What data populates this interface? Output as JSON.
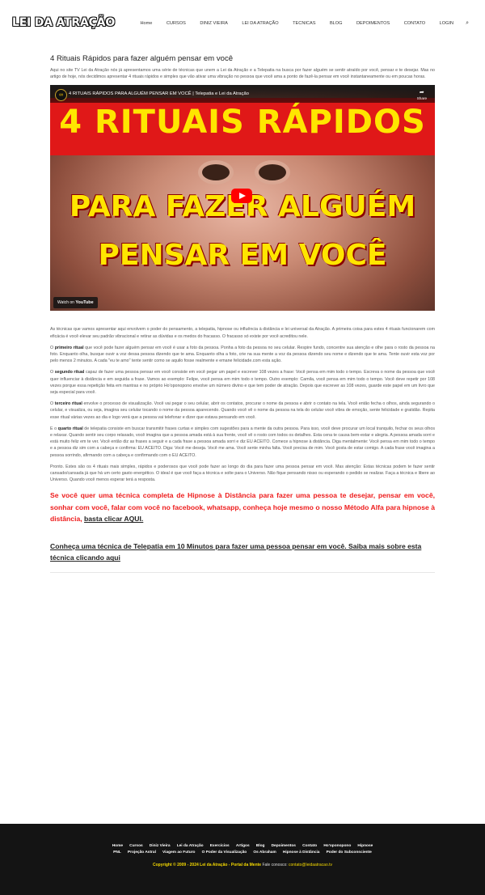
{
  "header": {
    "logo": "LEI DA ATRAÇÃO",
    "nav": [
      "Home",
      "CURSOS",
      "DINIZ VIEIRA",
      "LEI DA ATRAÇÃO",
      "TECNICAS",
      "BLOG",
      "DEPOIMENTOS",
      "CONTATO",
      "LOGIN"
    ],
    "search_icon": "⌕"
  },
  "article": {
    "title": "4 Rituais Rápidos para fazer alguém pensar em você",
    "intro": "Aqui no site TV Lei da Atração nós já apresentamos uma série de técnicas que unem a Lei da Atração e a Telepatia na busca por fazer alguém se sentir atraído por você, pensar e te desejar. Mas no artigo de hoje, nós decidimos apresentar 4 rituais rápidos e simples que vão ativar uma vibração no pessoa que você ama a ponto de fazê-la pensar em você instantaneamente ou em poucas horas.",
    "video": {
      "title": "4 RITUAIS RÁPIDOS PARA ALGUÉM PENSAR EM VOCÊ | Telepatia e Lei da Atração",
      "share": "Share",
      "headline1": "4 RITUAIS RÁPIDOS",
      "headline2": "PARA FAZER ALGUÉM",
      "headline3": "PENSAR EM VOCÊ",
      "watch_on": "Watch on",
      "youtube": "YouTube"
    },
    "p1": "As técnicas que vamos apresentar aqui envolvem o poder do pensamento, a telepatia, hipnose ou influência à distância e lei universal da Atração. A primeira coisa para estes 4 rituais funcionarem com eficácia é você elevar seu padrão vibracional e retirar as dúvidas e os medos do fracasso. O fracasso só existe por você acreditou nele.",
    "r1_label": "primeiro ritual",
    "r1_pre": "O ",
    "r1_text": " que você pode fazer alguém pensar em você é usar a foto da pessoa. Ponha a foto da pessoa no seu celular. Respire fundo, concentre sua atenção e olhe para o rosto da pessoa na foto. Enquanto olha, busque ouvir a voz dessa pessoa dizendo que te ama. Enquanto olha a foto, crie na sua mente a voz da pessoa dizendo seu nome e dizendo que te ama. Tente ouvir esta voz por pelo menos 2 minutos. A cada \"eu te amo\" tente sentir como se aquilo fosse realmente e emane felicidade.com esta ação.",
    "r2_label": "segundo ritual",
    "r2_pre": "O ",
    "r2_text": " capaz de fazer uma pessoa pensar em você consiste em você pegar um papel e escrever 108 vezes a frase: Você pensa em mim todo o tempo. Escreva o nome da pessoa que você quer influenciar à distância e em seguida a frase. Vamos ao exemplo: Felipe, você pensa em mim todo o tempo. Outro exemplo: Camila, você pensa em mim todo o tempo. Você deve repetir por 108 vezes porque essa repetição feita em mantras e no próprio Ho'oponopono envolve um número divino e que tem poder de atração. Depois que escrever as 108 vezes, guarde este papel em um livro que seja especial para você.",
    "r3_label": "terceiro ritual",
    "r3_pre": "O ",
    "r3_text": " envolve o processo de visualização. Você vai pegar o seu celular, abrir os contatos, procurar o nome da pessoa e abrir o contato na tela. Você então fecha o olhos, ainda segurando o celular, e visualiza, ou seja, imagina seu celular tocando o nome da pessoa aparecendo. Quando você vê o nome da pessoa na tela do celular você vibra de emoção, sente felicidade e gratidão. Repita esse ritual várias vezes ao dia e logo verá que a pessoa vai telefonar e dizer que estava pensando em você.",
    "r4_label": "quarto ritual",
    "r4_pre": "E o ",
    "r4_text": " de telepatia consiste em buscar transmitir frases curtas e simples com sugestões para a mente da outra pessoa. Para isso, você deve procurar um local tranquilo, fechar os seus olhos e relaxar. Quando sentir seu corpo relaxado, você imagina que a pessoa amada está à sua frente, você vê o rosto com todos os detalhes. Esta cena te causa bem-estar e alegria. A pessoa amada sorri e está muito feliz em te ver. Você então diz as frases a seguir e a cada frase a pessoa amada sorri e diz EU ACEITO. Comece a hipnose à distância. Diga mentalmente: Você pensa em mim todo o tempo e a pessoa diz sim com a cabeça e confirma: EU ACEITO. Diga: Você me deseja. Você me ama. Você sente minha falta. Você precisa de mim. Você gosta de estar comigo. A cada frase você imagina a pessoa sorrindo, afirmando com a cabeça e confirmando com o EU ACEITO.",
    "p_end": "Pronto. Estes são os 4 rituais mais simples, rápidos e poderosos que você pode fazer ao longo do dia para fazer uma pessoa pensar em você. Mas atenção: Estas técnicas podem te fazer sentir cansado/cansada já que há um certo gasto energético. O ideal é que você faça a técnica e solte para o Universo. Não fique pensando nisso ou esperando o pedido se realizar. Faça a técnica e libere ao Universo. Quando você menos esperar terá a resposta.",
    "promo_text": "Se você quer uma técnica completa de Hipnose à Distância para fazer uma pessoa te desejar, pensar em você, sonhar com você, falar com você no facebook, whatsapp, conheça hoje mesmo o nosso Método Alfa para hipnose à distância, ",
    "promo_link": "basta clicar AQUI.",
    "promo2": "Conheça uma técnica de Telepatia em 10 Minutos para fazer uma pessoa pensar em você. Saiba mais sobre esta técnica clicando aqui"
  },
  "footer": {
    "row1": [
      "Home",
      "Cursos",
      "Diniz Vieira",
      "Lei da Atração",
      "Exercícios",
      "Artigos",
      "Blog",
      "Depoimentos",
      "Contato",
      "Ho'oponopono",
      "Hipnose"
    ],
    "row2": [
      "PNL",
      "Projeção Astral",
      "Viagem ao Futuro",
      "O Poder da Visualização",
      "Os Abraham",
      "Hipnose à Distância",
      "Poder do Subconsciente"
    ],
    "copyright": "Copyright © 2009 - 2024 Lei da Atração - Portal da Mente",
    "contact_label": " Fale conosco: ",
    "contact_email": "contato@leidaatracao.tv"
  },
  "colors": {
    "accent_red": "#ee1c1c",
    "footer_bg": "#141414",
    "footer_yellow": "#f4d800"
  }
}
